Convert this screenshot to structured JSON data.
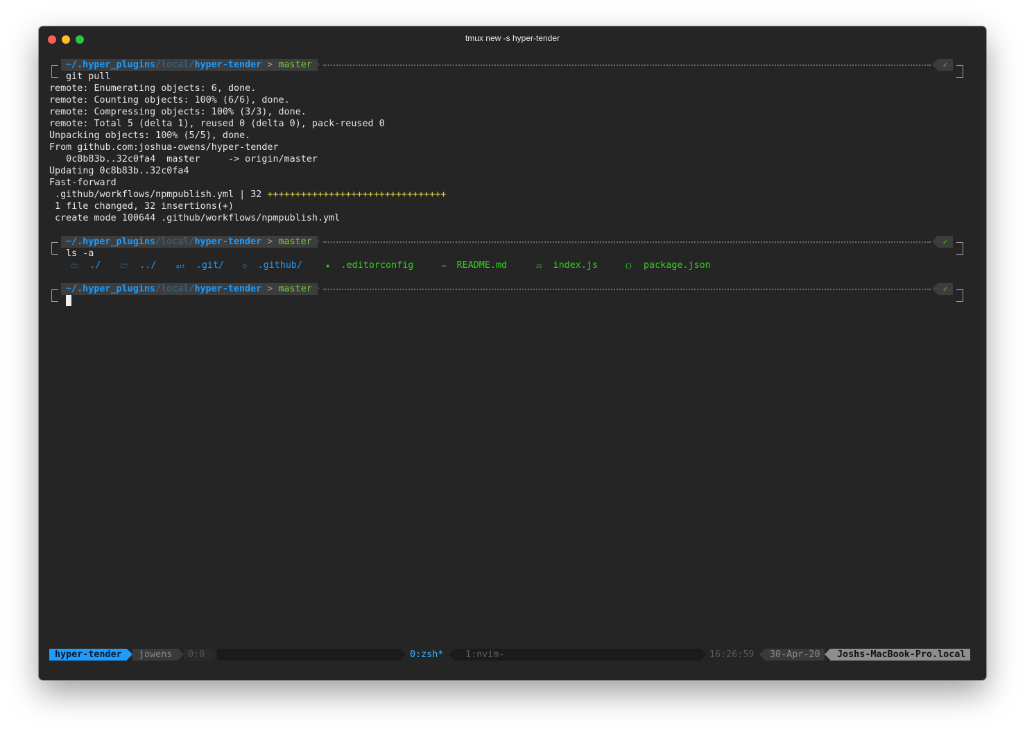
{
  "window": {
    "title": "tmux new -s hyper-tender"
  },
  "prompt": {
    "tilde": "~/",
    "path_a": ".hyper_plugins",
    "path_b": "/local/",
    "path_c": "hyper-tender",
    "sep": ">",
    "branch": "master",
    "status_check": "✓"
  },
  "commands": {
    "first": "git pull",
    "second": "ls -a"
  },
  "output_lines": [
    "remote: Enumerating objects: 6, done.",
    "remote: Counting objects: 100% (6/6), done.",
    "remote: Compressing objects: 100% (3/3), done.",
    "remote: Total 5 (delta 1), reused 0 (delta 0), pack-reused 0",
    "Unpacking objects: 100% (5/5), done.",
    "From github.com:joshua-owens/hyper-tender",
    "   0c8b83b..32c0fa4  master     -> origin/master",
    "Updating 0c8b83b..32c0fa4",
    "Fast-forward"
  ],
  "diffstat": {
    "file_line": " .github/workflows/npmpublish.yml | 32 ",
    "plus": "++++++++++++++++++++++++++++++++",
    "summary": " 1 file changed, 32 insertions(+)",
    "create": " create mode 100644 .github/workflows/npmpublish.yml"
  },
  "ls_entries": [
    {
      "icon": "folder-icon",
      "glyph": "🗁",
      "name": "./",
      "color": "#1c9cff"
    },
    {
      "icon": "folder-icon",
      "glyph": "🗁",
      "name": "../",
      "color": "#1c9cff"
    },
    {
      "icon": "git-icon",
      "glyph": "git",
      "name": ".git/",
      "color": "#1c9cff"
    },
    {
      "icon": "github-icon",
      "glyph": "◯",
      "name": ".github/",
      "color": "#1c9cff"
    },
    {
      "icon": "gear-icon",
      "glyph": "✹",
      "name": ".editorconfig",
      "color": "#2ed31b"
    },
    {
      "icon": "markdown-icon",
      "glyph": "▭",
      "name": "README.md",
      "color": "#2ed31b"
    },
    {
      "icon": "javascript-icon",
      "glyph": "JS",
      "name": "index.js",
      "color": "#2ed31b"
    },
    {
      "icon": "json-icon",
      "glyph": "{}",
      "name": "package.json",
      "color": "#2ed31b"
    }
  ],
  "statusbar": {
    "session": "hyper-tender",
    "user": "jowens",
    "pane": "0:0",
    "window_active": "0:zsh*",
    "window_inactive": "1:nvim-",
    "time": "16:26:59",
    "date": "30-Apr-20",
    "host": "Joshs-MacBook-Pro.local"
  },
  "colors": {
    "background": "#252525",
    "path_blue": "#1c9cff",
    "branch_green": "#7ad035",
    "file_green": "#2ed31b",
    "plus_yellow": "#d9d34a",
    "session_blue": "#1c9cff"
  }
}
